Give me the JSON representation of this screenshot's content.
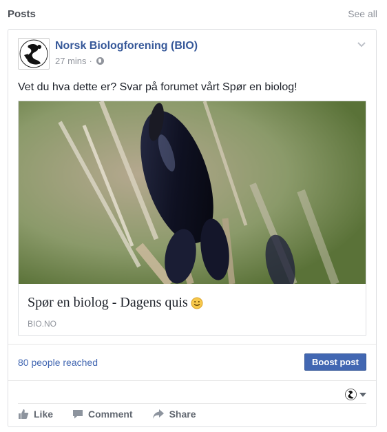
{
  "section": {
    "title": "Posts",
    "see_all": "See all"
  },
  "post": {
    "page_name": "Norsk Biologforening (BIO)",
    "time": "27 mins",
    "separator": "·",
    "text": "Vet du hva dette er? Svar på forumet vårt Spør en biolog!",
    "link": {
      "title": "Spør en biolog - Dagens quis",
      "domain": "BIO.NO"
    },
    "reach": "80 people reached",
    "boost_label": "Boost post",
    "actions": {
      "like": "Like",
      "comment": "Comment",
      "share": "Share"
    }
  },
  "icons": [
    "globe-icon",
    "chevron-down-icon",
    "smiley-icon",
    "like-icon",
    "comment-icon",
    "share-icon"
  ]
}
